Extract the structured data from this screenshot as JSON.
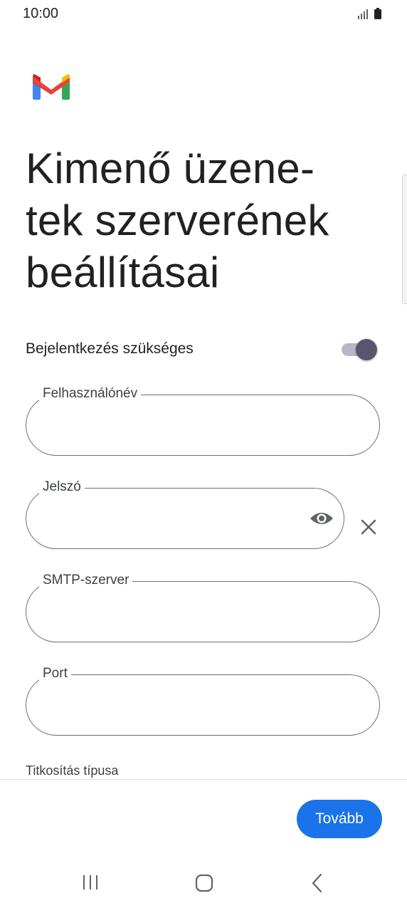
{
  "status_bar": {
    "time": "10:00",
    "icons": [
      "signal-icon",
      "battery-icon"
    ]
  },
  "app": {
    "logo": "gmail-logo-icon",
    "colors": {
      "accent": "#1a73e8",
      "toggle_thumb": "#5b5470",
      "toggle_track": "#b9b6c3",
      "outline": "#6f6f6f"
    }
  },
  "page": {
    "title": "Kimenő üzene-tek szerverének beállításai"
  },
  "login_toggle": {
    "label": "Bejelentkezés szükséges",
    "enabled": true
  },
  "fields": {
    "username": {
      "label": "Felhasználónév",
      "value": ""
    },
    "password": {
      "label": "Jelszó",
      "value": "",
      "icons": [
        "eye-icon",
        "close-icon"
      ]
    },
    "smtp": {
      "label": "SMTP-szerver",
      "value": ""
    },
    "port": {
      "label": "Port",
      "value": ""
    }
  },
  "encryption": {
    "label": "Titkosítás típusa"
  },
  "footer": {
    "next_label": "Tovább"
  },
  "nav_bar": {
    "icons": [
      "recents-icon",
      "home-icon",
      "back-icon"
    ]
  }
}
